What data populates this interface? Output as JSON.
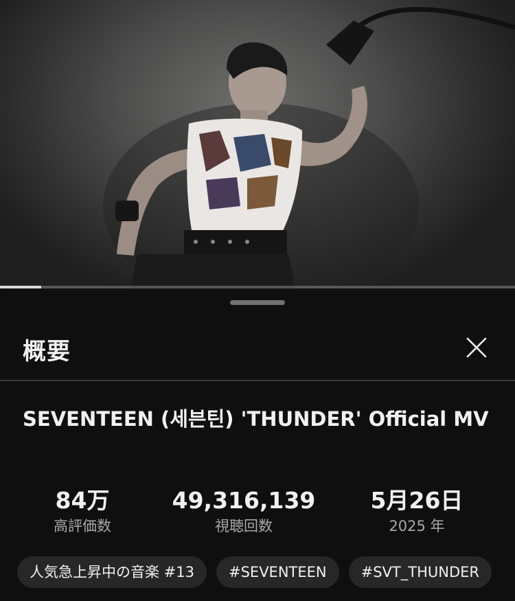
{
  "video": {
    "progress": 0.08
  },
  "description_sheet": {
    "title": "概要",
    "close_icon": "close-icon",
    "video_title": "SEVENTEEN (세븐틴) 'THUNDER' Official MV",
    "stats": [
      {
        "value": "84万",
        "label": "高評価数"
      },
      {
        "value": "49,316,139",
        "label": "視聴回数"
      },
      {
        "value": "5月26日",
        "label": "2025 年"
      }
    ],
    "chips": [
      "人気急上昇中の音楽 #13",
      "#SEVENTEEN",
      "#SVT_THUNDER"
    ]
  },
  "colors": {
    "background": "#0f0f0f",
    "text_primary": "#f1f1f1",
    "text_secondary": "#aaaaaa",
    "chip_background": "#272727",
    "divider": "#3a3a3a"
  }
}
